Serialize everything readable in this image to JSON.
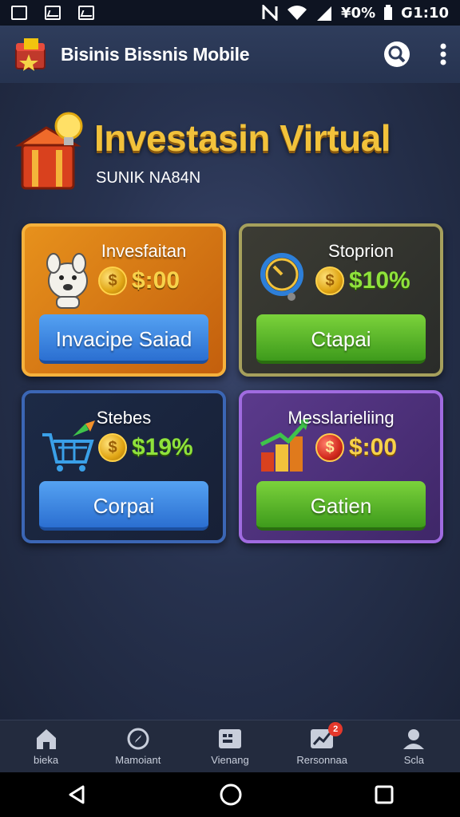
{
  "status_bar": {
    "battery_text": "¥0%",
    "time": "Ԍ1:10",
    "icons": [
      "notification-icon",
      "image-icon",
      "photo-icon",
      "nfc-icon",
      "wifi-icon",
      "signal-icon",
      "battery-icon"
    ]
  },
  "app_bar": {
    "title": "Bisinis Bissnis Mobile",
    "icons": [
      "app-logo-icon",
      "search-icon",
      "more-vert-icon"
    ]
  },
  "hero": {
    "title": "Investasin Virtual",
    "subtitle": "SUNIK NA84N",
    "icon": "treasure-chest-icon"
  },
  "cards": [
    {
      "title": "Invesfaitan",
      "value": "$:00",
      "button": "Invacipe Saiad",
      "icon": "dog-mascot-icon",
      "coin": "dollar-coin-icon",
      "accent": "#e7911c",
      "button_color": "#2b6fd1"
    },
    {
      "title": "Stoprion",
      "value": "$10%",
      "button": "Ctapai",
      "icon": "magnifier-icon",
      "coin": "dollar-coin-icon",
      "accent": "#a6a05c",
      "button_color": "#3e9b1c"
    },
    {
      "title": "Stebes",
      "value": "$19%",
      "button": "Corpai",
      "icon": "shopping-cart-icon",
      "coin": "dollar-coin-icon",
      "accent": "#3b66b5",
      "button_color": "#2b6fd1"
    },
    {
      "title": "Messlarieliing",
      "value": "$:00",
      "button": "Gatien",
      "icon": "growth-chart-icon",
      "coin": "red-dollar-coin-icon",
      "accent": "#a06be0",
      "button_color": "#3e9b1c"
    }
  ],
  "coin_symbol": "$",
  "bottom_nav": [
    {
      "label": "bieka",
      "icon": "home-icon"
    },
    {
      "label": "Mamoiant",
      "icon": "compass-icon"
    },
    {
      "label": "Vienang",
      "icon": "dashboard-icon"
    },
    {
      "label": "Rersonnaa",
      "icon": "chart-icon",
      "badge": "2"
    },
    {
      "label": "Scla",
      "icon": "profile-icon"
    }
  ],
  "system_nav": [
    "back-icon",
    "home-circle-icon",
    "recents-icon"
  ]
}
